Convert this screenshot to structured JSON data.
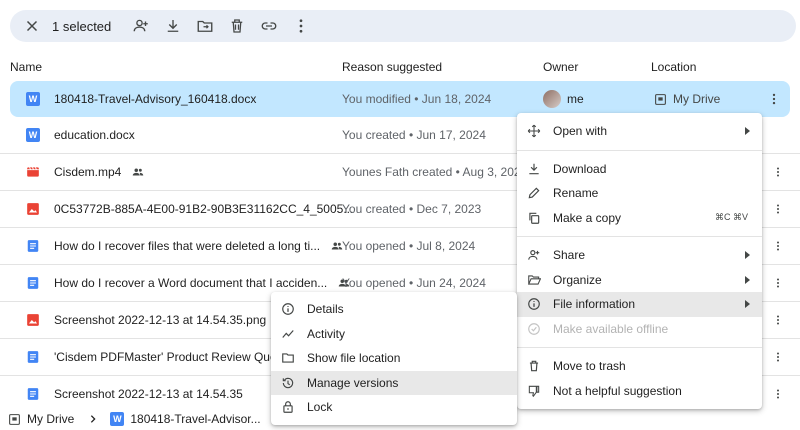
{
  "toolbar": {
    "selected_count": "1 selected"
  },
  "header": {
    "name": "Name",
    "reason": "Reason suggested",
    "owner": "Owner",
    "location": "Location"
  },
  "rows": [
    {
      "name": "180418-Travel-Advisory_160418.docx",
      "reason": "You modified • Jun 18, 2024",
      "owner": "me",
      "location": "My Drive",
      "type": "word"
    },
    {
      "name": "education.docx",
      "reason": "You created • Jun 17, 2024",
      "type": "word"
    },
    {
      "name": "Cisdem.mp4",
      "reason": "Younes Fath created • Aug 3, 2024",
      "type": "video",
      "shared": true
    },
    {
      "name": "0C53772B-885A-4E00-91B2-90B3E31162CC_4_5005...",
      "reason": "You created • Dec 7, 2023",
      "type": "image"
    },
    {
      "name": "How do I recover files that were deleted a long ti...",
      "reason": "You opened • Jul 8, 2024",
      "type": "doc",
      "shared": true
    },
    {
      "name": "How do I recover a Word document that I acciden...",
      "reason": "You opened • Jun 24, 2024",
      "type": "doc",
      "shared": true
    },
    {
      "name": "Screenshot 2022-12-13 at 14.54.35.png",
      "reason": "",
      "type": "image"
    },
    {
      "name": "'Cisdem PDFMaster' Product Review Questi",
      "reason": "",
      "type": "doc"
    },
    {
      "name": "Screenshot 2022-12-13 at 14.54.35",
      "reason": "",
      "type": "doc"
    }
  ],
  "main_menu": {
    "open_with": "Open with",
    "download": "Download",
    "rename": "Rename",
    "make_copy": "Make a copy",
    "make_copy_shortcut": "⌘C ⌘V",
    "share": "Share",
    "organize": "Organize",
    "file_information": "File information",
    "make_offline": "Make available offline",
    "move_trash": "Move to trash",
    "not_helpful": "Not a helpful suggestion"
  },
  "sub_menu": {
    "details": "Details",
    "activity": "Activity",
    "show_location": "Show file location",
    "manage_versions": "Manage versions",
    "lock": "Lock"
  },
  "breadcrumb": {
    "root": "My Drive",
    "file": "180418-Travel-Advisor..."
  },
  "file_type_letters": {
    "word": "W"
  }
}
